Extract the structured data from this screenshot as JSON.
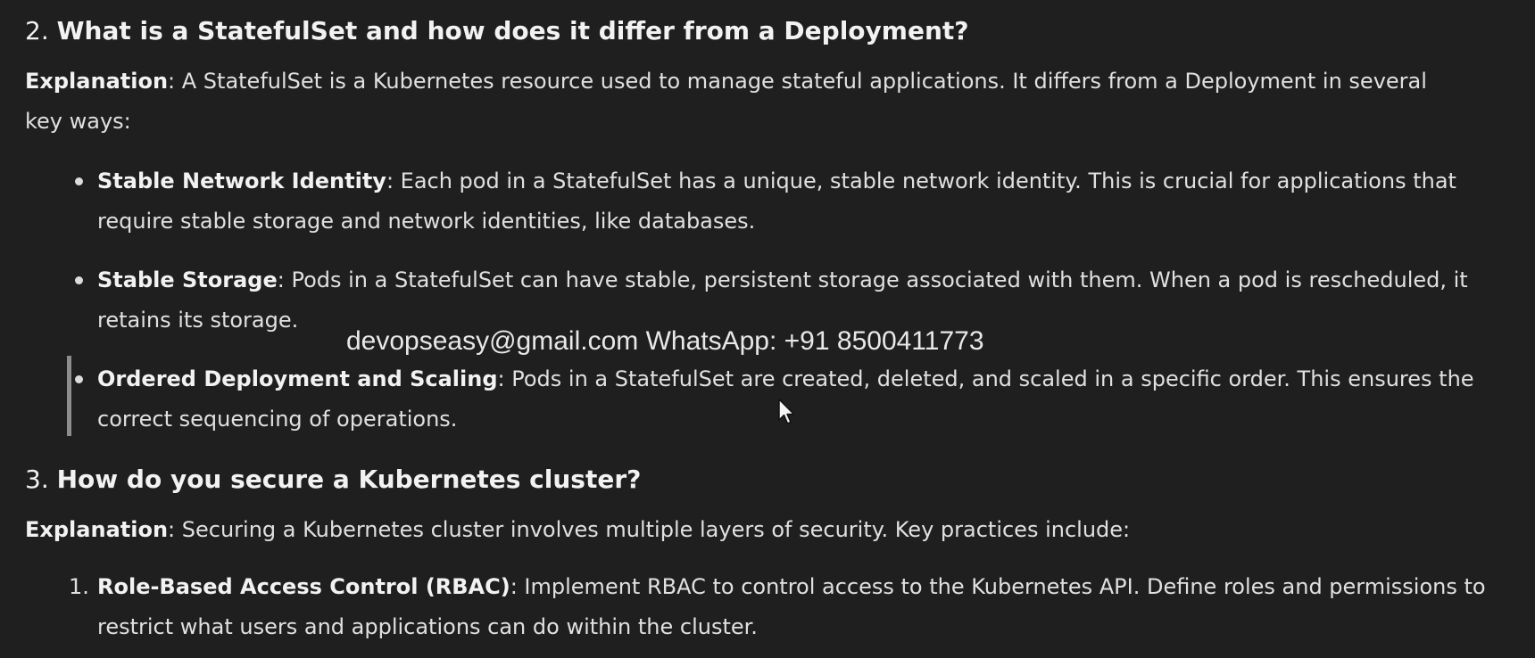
{
  "q2": {
    "number": "2.",
    "title": "What is a StatefulSet and how does it differ from a Deployment?",
    "explanation_label": "Explanation",
    "explanation_text": ": A StatefulSet is a Kubernetes resource used to manage stateful applications. It differs from a Deployment in several key ways:",
    "items": [
      {
        "term": "Stable Network Identity",
        "text": ": Each pod in a StatefulSet has a unique, stable network identity. This is crucial for applications that require stable storage and network identities, like databases."
      },
      {
        "term": "Stable Storage",
        "text": ": Pods in a StatefulSet can have stable, persistent storage associated with them. When a pod is rescheduled, it retains its storage."
      },
      {
        "term": "Ordered Deployment and Scaling",
        "text": ": Pods in a StatefulSet are created, deleted, and scaled in a specific order. This ensures the correct sequencing of operations."
      }
    ]
  },
  "q3": {
    "number": "3.",
    "title": "How do you secure a Kubernetes cluster?",
    "explanation_label": "Explanation",
    "explanation_text": ": Securing a Kubernetes cluster involves multiple layers of security. Key practices include:",
    "items": [
      {
        "marker": "1.",
        "term": "Role-Based Access Control (RBAC)",
        "text": ": Implement RBAC to control access to the Kubernetes API. Define roles and permissions to restrict what users and applications can do within the cluster."
      }
    ]
  },
  "watermark": "devopseasy@gmail.com WhatsApp: +91 8500411773",
  "cursor_icon": "mouse-pointer-icon"
}
